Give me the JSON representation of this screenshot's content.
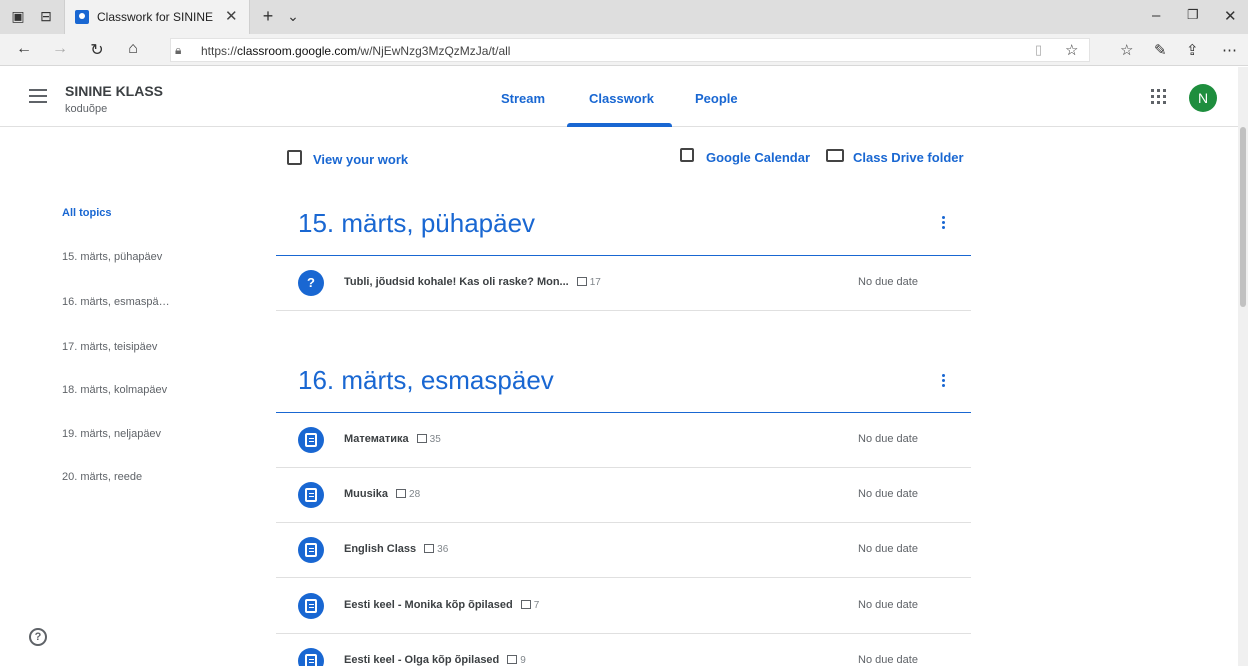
{
  "browser": {
    "tab_title": "Classwork for SININE KL",
    "url_prefix": "https://",
    "url_host": "classroom.google.com",
    "url_path": "/w/NjEwNzg3MzQzMzJa/t/all"
  },
  "header": {
    "class_name": "SININE KLASS",
    "class_subtitle": "koduõpe",
    "tabs": [
      "Stream",
      "Classwork",
      "People"
    ],
    "active_tab": "Classwork",
    "avatar_letter": "N"
  },
  "top_links": {
    "view_work": "View your work",
    "calendar": "Google Calendar",
    "drive": "Class Drive folder"
  },
  "topics_nav": [
    "All topics",
    "15. märts, pühapäev",
    "16. märts, esmaspä…",
    "17. märts, teisipäev",
    "18. märts, kolmapäev",
    "19. märts, neljapäev",
    "20. märts, reede"
  ],
  "sections": [
    {
      "title": "15. märts, pühapäev",
      "items": [
        {
          "title": "Tubli, jõudsid kohale! Kas oli raske? Mon...",
          "comments": "17",
          "due": "No due date",
          "type": "question"
        }
      ]
    },
    {
      "title": "16. märts, esmaspäev",
      "items": [
        {
          "title": "Математика",
          "comments": "35",
          "due": "No due date",
          "type": "assignment"
        },
        {
          "title": "Muusika",
          "comments": "28",
          "due": "No due date",
          "type": "assignment"
        },
        {
          "title": "English Class",
          "comments": "36",
          "due": "No due date",
          "type": "assignment"
        },
        {
          "title": "Eesti keel - Monika kõp õpilased",
          "comments": "7",
          "due": "No due date",
          "type": "assignment"
        },
        {
          "title": "Eesti keel - Olga kõp õpilased",
          "comments": "9",
          "due": "No due date",
          "type": "assignment"
        }
      ]
    }
  ],
  "colors": {
    "accent": "#1967d2",
    "avatar": "#1e8e3e"
  }
}
